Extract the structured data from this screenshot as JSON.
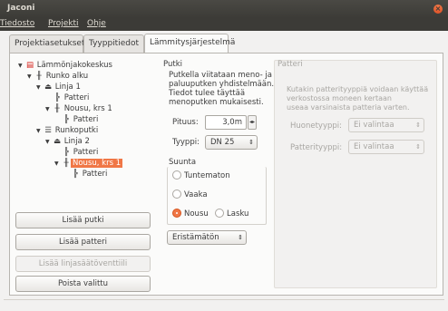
{
  "window": {
    "title": "Jaconi",
    "close_icon": "×"
  },
  "menu": {
    "items": [
      "Tiedosto",
      "Projekti",
      "Ohje"
    ]
  },
  "tabs": [
    "Projektiasetukset",
    "Tyyppitiedot",
    "Lämmitysjärjestelmä"
  ],
  "tree": {
    "nodes": [
      {
        "label": "Lämmönjakokeskus",
        "icon": "heat-center-icon"
      },
      {
        "label": "Runko alku",
        "icon": "trunk-start-icon"
      },
      {
        "label": "Linja 1",
        "icon": "line-icon"
      },
      {
        "label": "Patteri",
        "icon": "radiator-icon"
      },
      {
        "label": "Nousu, krs 1",
        "icon": "riser-icon"
      },
      {
        "label": "Patteri",
        "icon": "radiator-icon"
      },
      {
        "label": "Runkoputki",
        "icon": "trunk-pipe-icon"
      },
      {
        "label": "Linja 2",
        "icon": "line-icon"
      },
      {
        "label": "Patteri",
        "icon": "radiator-icon"
      },
      {
        "label": "Nousu, krs 1",
        "icon": "riser-icon",
        "selected": true
      },
      {
        "label": "Patteri",
        "icon": "radiator-icon"
      }
    ]
  },
  "buttons": {
    "add_pipe": "Lisää putki",
    "add_radiator": "Lisää patteri",
    "add_valve": "Lisää linjasäätöventtiili",
    "delete": "Poista valittu"
  },
  "pipe": {
    "title": "Putki",
    "description": [
      "Putkella viitataan meno- ja",
      "paluuputken yhdistelmään.",
      "Tiedot tulee täyttää",
      "menoputken mukaisesti."
    ],
    "length_label": "Pituus:",
    "length_value": "3,0m",
    "type_label": "Tyyppi:",
    "type_value": "DN 25",
    "direction_title": "Suunta",
    "directions": [
      "Tuntematon",
      "Vaaka",
      "Nousu",
      "Lasku"
    ],
    "selected_direction": "Nousu",
    "insulation_value": "Eristämätön"
  },
  "radiator": {
    "title": "Patteri",
    "description": [
      "Kutakin patterityyppiä voidaan käyttää",
      "verkostossa moneen kertaan",
      "useaa varsinaista patteria varten."
    ],
    "room_type_label": "Huonetyyppi:",
    "room_type_value": "Ei valintaa",
    "radiator_type_label": "Patterityyppi:",
    "radiator_type_value": "Ei valintaa"
  },
  "colors": {
    "accent": "#f07746",
    "titlebar": "#3c3b37",
    "background": "#f2f1f0"
  }
}
